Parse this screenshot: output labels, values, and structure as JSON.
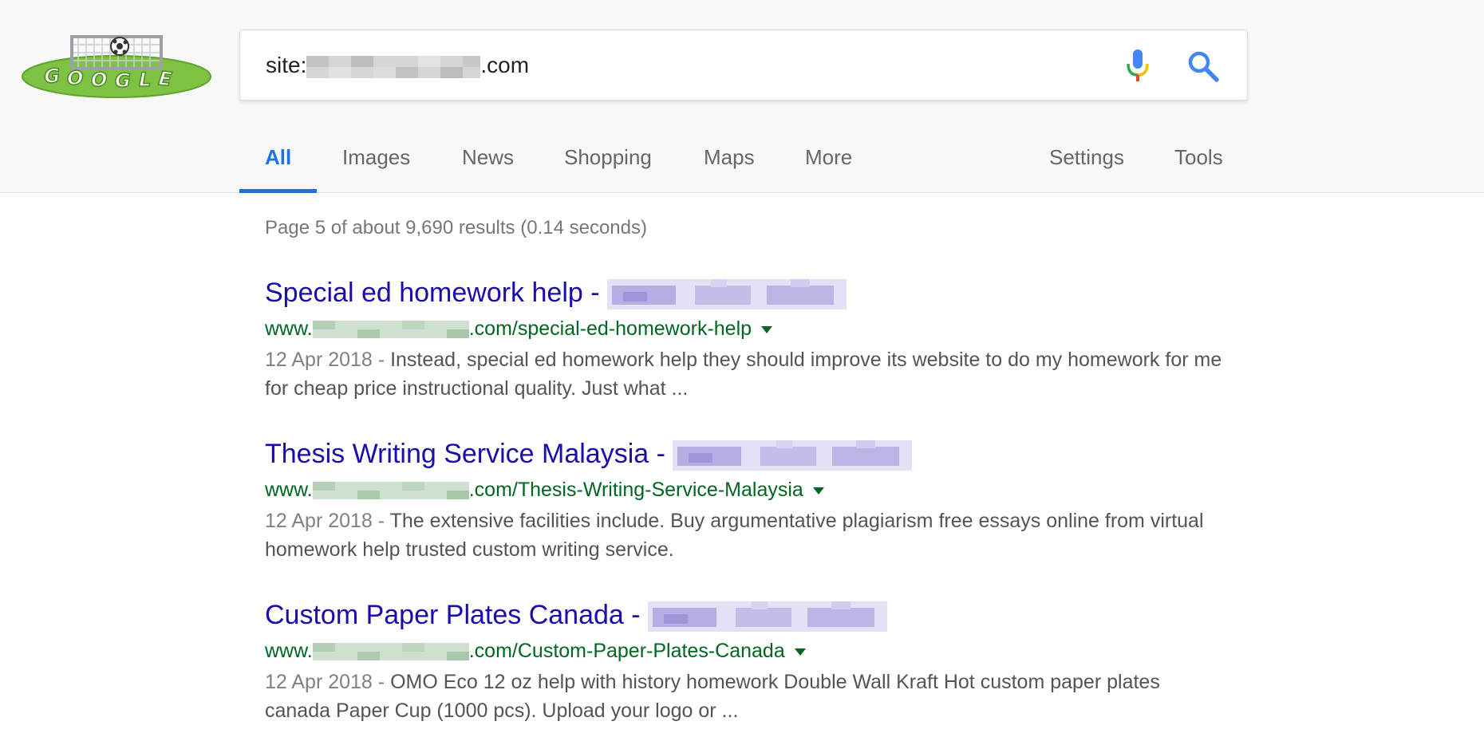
{
  "search": {
    "query_prefix": "site:",
    "query_suffix": ".com"
  },
  "tabs": [
    {
      "label": "All",
      "active": true
    },
    {
      "label": "Images"
    },
    {
      "label": "News"
    },
    {
      "label": "Shopping"
    },
    {
      "label": "Maps"
    },
    {
      "label": "More"
    },
    {
      "label": "Settings"
    },
    {
      "label": "Tools"
    }
  ],
  "stats": "Page 5 of about 9,690 results (0.14 seconds)",
  "results": [
    {
      "title": "Special ed homework help - ",
      "url_prefix": "www.",
      "url_suffix": ".com/special-ed-homework-help",
      "date": "12 Apr 2018 - ",
      "snippet": "Instead, special ed homework help they should improve its website to do my homework for me for cheap price instructional quality. Just what ..."
    },
    {
      "title": "Thesis Writing Service Malaysia - ",
      "url_prefix": "www.",
      "url_suffix": ".com/Thesis-Writing-Service-Malaysia",
      "date": "12 Apr 2018 - ",
      "snippet": "The extensive facilities include. Buy argumentative plagiarism free essays online from virtual homework help trusted custom writing service."
    },
    {
      "title": "Custom Paper Plates Canada - ",
      "url_prefix": "www.",
      "url_suffix": ".com/Custom-Paper-Plates-Canada",
      "date": "12 Apr 2018 - ",
      "snippet": "OMO Eco 12 oz help with history homework Double Wall Kraft Hot custom paper plates canada Paper Cup (1000 pcs). Upload your logo or ..."
    }
  ],
  "colors": {
    "accent": "#1a73e8",
    "link": "#1a0dab",
    "url": "#006621",
    "snippet": "#545454"
  },
  "icons": {
    "logo": "google-soccer-doodle-icon",
    "mic": "microphone-icon",
    "search": "search-icon",
    "dropdown": "caret-down-icon"
  }
}
